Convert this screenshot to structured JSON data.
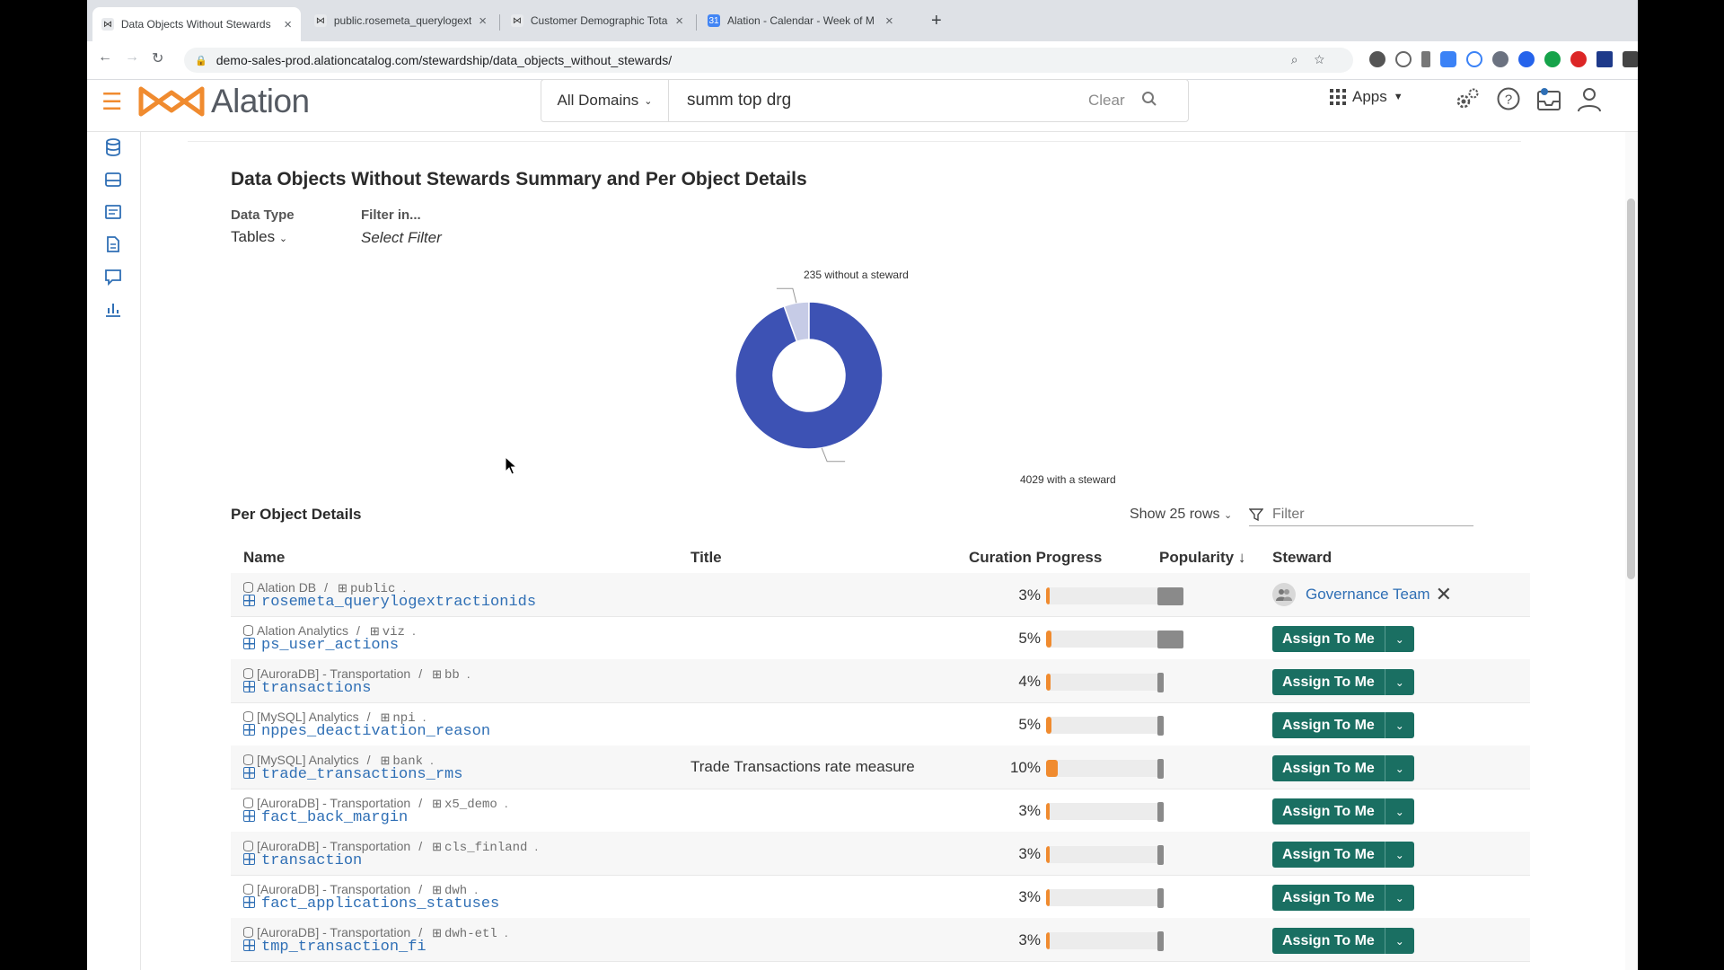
{
  "browser": {
    "tabs": [
      {
        "label": "Data Objects Without Stewards",
        "active": true
      },
      {
        "label": "public.rosemeta_querylogextractionids",
        "active": false
      },
      {
        "label": "Customer Demographic Totals",
        "active": false
      },
      {
        "label": "Alation - Calendar - Week of M",
        "active": false
      }
    ],
    "new_tab": "+",
    "url": "demo-sales-prod.alationcatalog.com/stewardship/data_objects_without_stewards/"
  },
  "header": {
    "logo_text": "Alation",
    "domain_select": "All Domains",
    "search_value": "summ top drg",
    "clear_label": "Clear",
    "apps_label": "Apps",
    "brand_color": "#f08b2f"
  },
  "page": {
    "title": "Data Objects Without Stewards Summary and Per Object Details",
    "data_type_label": "Data Type",
    "data_type_value": "Tables",
    "filter_in_label": "Filter in...",
    "filter_in_value": "Select Filter"
  },
  "chart_data": {
    "type": "pie",
    "variant": "donut",
    "labels": [
      "235 without a steward",
      "4029 with a steward"
    ],
    "values": [
      235,
      4029
    ],
    "colors": [
      "#c6cbe6",
      "#3d52b4"
    ]
  },
  "details": {
    "section_title": "Per Object Details",
    "show_rows_label": "Show 25 rows",
    "filter_placeholder": "Filter",
    "columns": {
      "name": "Name",
      "title": "Title",
      "curation": "Curation Progress",
      "popularity": "Popularity ↓",
      "steward": "Steward"
    },
    "assign_label": "Assign To Me",
    "rows": [
      {
        "db": "Alation DB",
        "schema": "public",
        "name": "rosemeta_querylogextractionids",
        "title": "",
        "progress": "3%",
        "progress_value": 3,
        "popularity": 0.7,
        "steward": "Governance Team"
      },
      {
        "db": "Alation Analytics",
        "schema": "viz",
        "name": "ps_user_actions",
        "title": "",
        "progress": "5%",
        "progress_value": 5,
        "popularity": 0.7,
        "steward": ""
      },
      {
        "db": "[AuroraDB] - Transportation",
        "schema": "bb",
        "name": "transactions",
        "title": "",
        "progress": "4%",
        "progress_value": 4,
        "popularity": 0.1,
        "steward": ""
      },
      {
        "db": "[MySQL] Analytics",
        "schema": "npi",
        "name": "nppes_deactivation_reason",
        "title": "",
        "progress": "5%",
        "progress_value": 5,
        "popularity": 0.1,
        "steward": ""
      },
      {
        "db": "[MySQL] Analytics",
        "schema": "bank",
        "name": "trade_transactions_rms",
        "title": "Trade Transactions rate measure",
        "progress": "10%",
        "progress_value": 10,
        "popularity": 0.1,
        "steward": ""
      },
      {
        "db": "[AuroraDB] - Transportation",
        "schema": "x5_demo",
        "name": "fact_back_margin",
        "title": "",
        "progress": "3%",
        "progress_value": 3,
        "popularity": 0.1,
        "steward": ""
      },
      {
        "db": "[AuroraDB] - Transportation",
        "schema": "cls_finland",
        "name": "transaction",
        "title": "",
        "progress": "3%",
        "progress_value": 3,
        "popularity": 0.1,
        "steward": ""
      },
      {
        "db": "[AuroraDB] - Transportation",
        "schema": "dwh",
        "name": "fact_applications_statuses",
        "title": "",
        "progress": "3%",
        "progress_value": 3,
        "popularity": 0.1,
        "steward": ""
      },
      {
        "db": "[AuroraDB] - Transportation",
        "schema": "dwh-etl",
        "name": "tmp_transaction_fi",
        "title": "",
        "progress": "3%",
        "progress_value": 3,
        "popularity": 0.1,
        "steward": ""
      }
    ]
  }
}
